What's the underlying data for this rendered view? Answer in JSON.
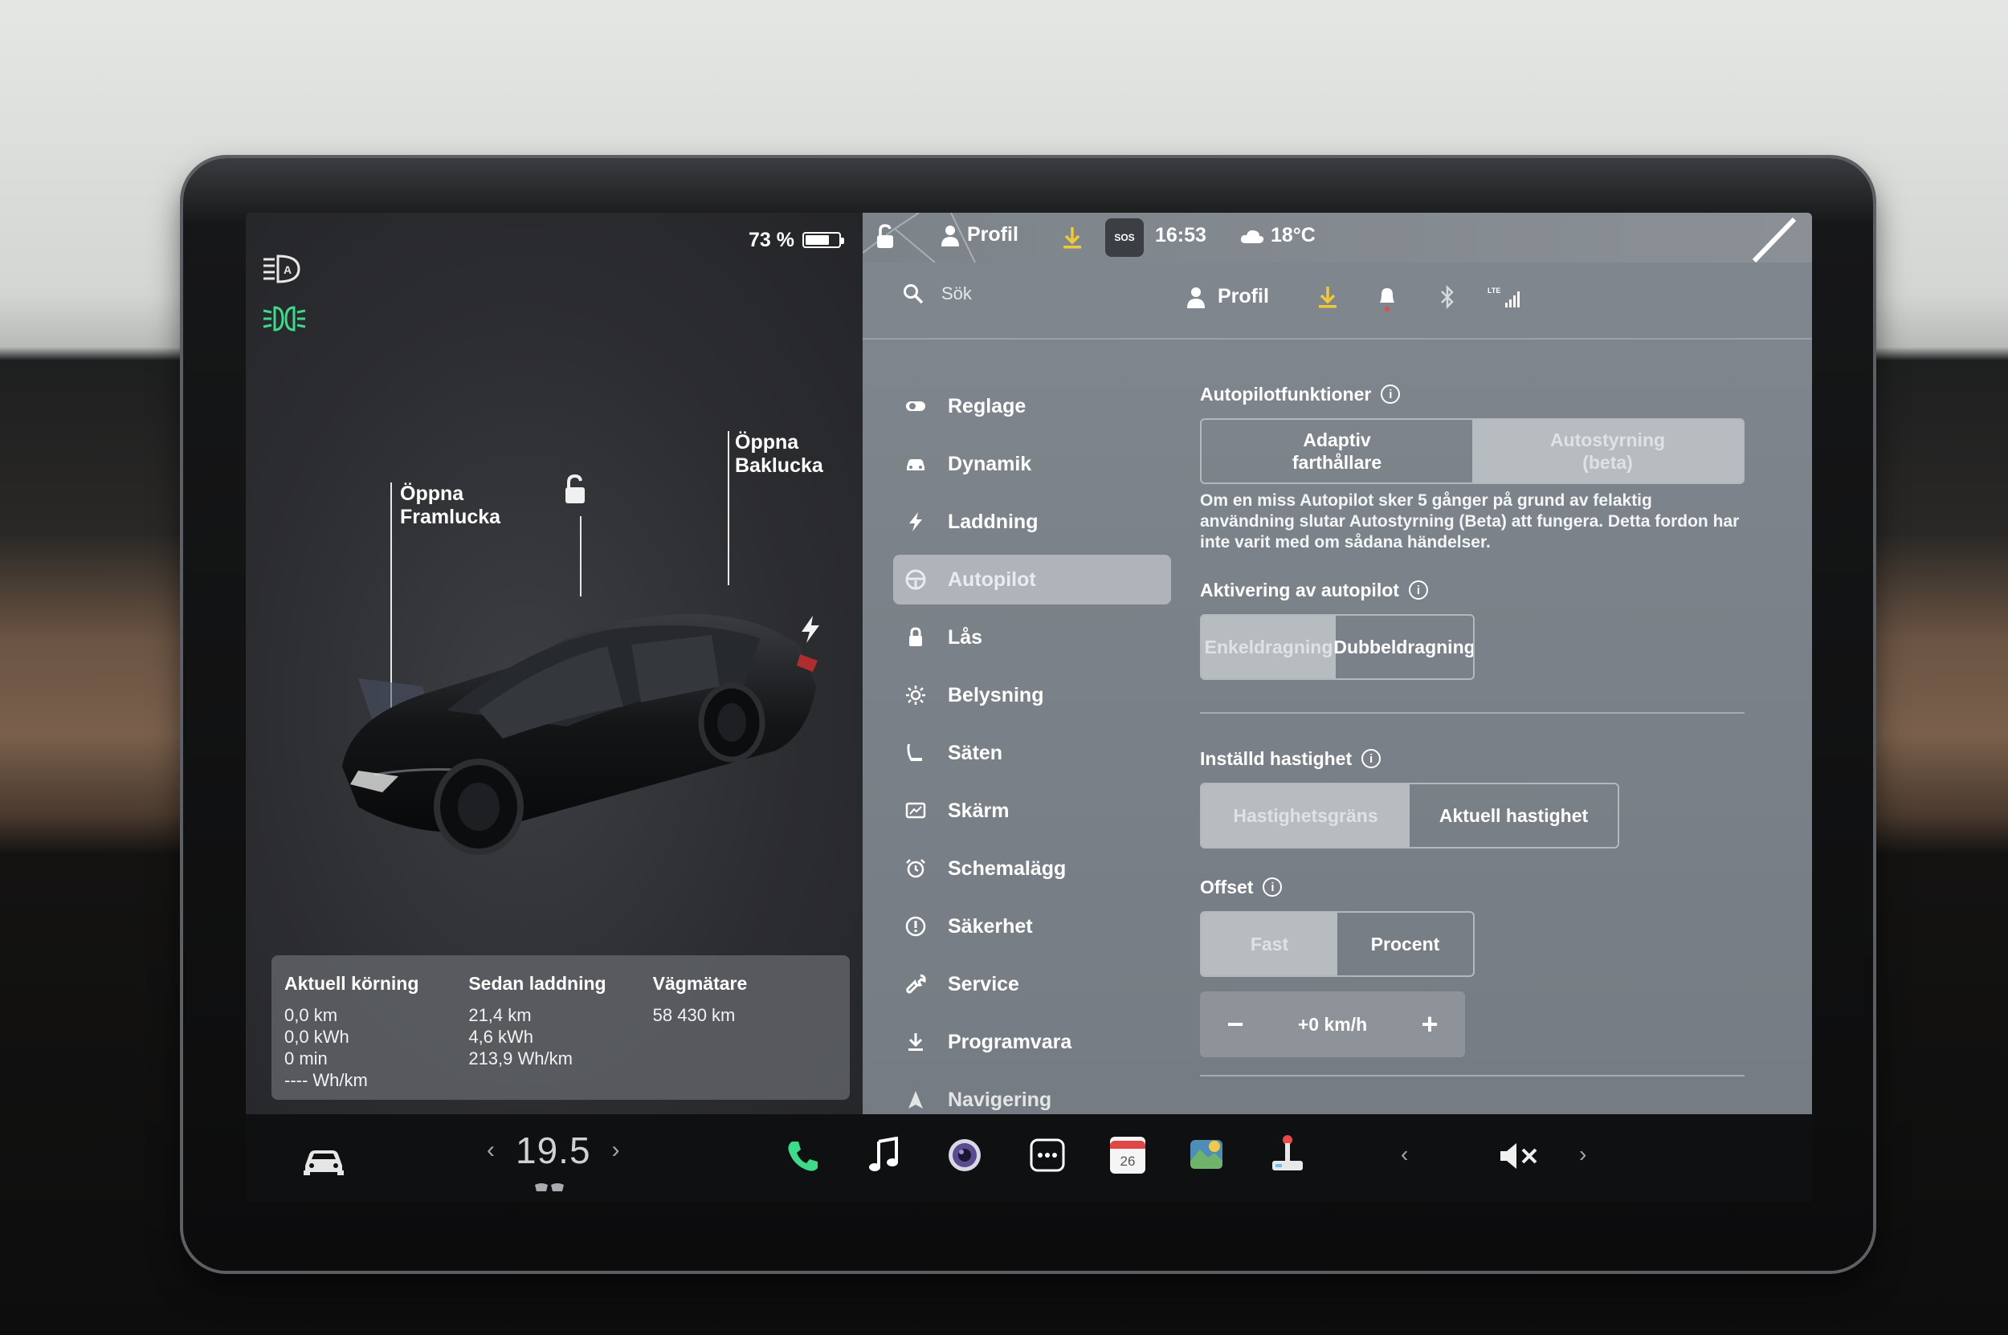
{
  "status": {
    "battery_percent": "73 %",
    "battery_level": 0.73,
    "profile": "Profil",
    "sos": "SOS",
    "time": "16:53",
    "temperature": "18°C"
  },
  "car": {
    "frunk_label_1": "Öppna",
    "frunk_label_2": "Framlucka",
    "trunk_label_1": "Öppna",
    "trunk_label_2": "Baklucka",
    "colors": {
      "body": "#111214",
      "glass": "#2c2f33",
      "highlight": "#4a4d52"
    }
  },
  "stats": {
    "current_drive": {
      "title": "Aktuell körning",
      "lines": [
        "0,0 km",
        "0,0 kWh",
        "0 min",
        "---- Wh/km"
      ]
    },
    "since_charge": {
      "title": "Sedan laddning",
      "lines": [
        "21,4 km",
        "4,6 kWh",
        "213,9 Wh/km"
      ]
    },
    "odometer": {
      "title": "Vägmätare",
      "lines": [
        "58 430 km"
      ]
    }
  },
  "header": {
    "search_placeholder": "Sök",
    "profile": "Profil"
  },
  "menu": [
    {
      "label": "Reglage",
      "icon": "toggle-icon"
    },
    {
      "label": "Dynamik",
      "icon": "car-icon"
    },
    {
      "label": "Laddning",
      "icon": "bolt-icon"
    },
    {
      "label": "Autopilot",
      "icon": "steering-wheel-icon",
      "active": true
    },
    {
      "label": "Lås",
      "icon": "lock-icon"
    },
    {
      "label": "Belysning",
      "icon": "sun-icon"
    },
    {
      "label": "Säten",
      "icon": "seat-icon"
    },
    {
      "label": "Skärm",
      "icon": "display-icon"
    },
    {
      "label": "Schemalägg",
      "icon": "alarm-clock-icon"
    },
    {
      "label": "Säkerhet",
      "icon": "alert-circle-icon"
    },
    {
      "label": "Service",
      "icon": "wrench-icon"
    },
    {
      "label": "Programvara",
      "icon": "download-icon"
    },
    {
      "label": "Navigering",
      "icon": "navigation-icon"
    }
  ],
  "autopilot": {
    "features_title": "Autopilotfunktioner",
    "features_options": [
      {
        "label_1": "Adaptiv",
        "label_2": "farthållare",
        "selected": false
      },
      {
        "label_1": "Autostyrning",
        "label_2": "(beta)",
        "selected": true
      }
    ],
    "features_description": "Om en miss Autopilot sker 5 gånger på grund av felaktig användning slutar Autostyrning (Beta) att fungera. Detta fordon har inte varit med om sådana händelser.",
    "activation_title": "Aktivering av autopilot",
    "activation_options": [
      {
        "label": "Enkeldragning",
        "selected": true
      },
      {
        "label": "Dubbeldragning",
        "selected": false
      }
    ],
    "speed_title": "Inställd hastighet",
    "speed_options": [
      {
        "label": "Hastighetsgräns",
        "selected": true
      },
      {
        "label": "Aktuell hastighet",
        "selected": false
      }
    ],
    "offset_title": "Offset",
    "offset_options": [
      {
        "label": "Fast",
        "selected": true
      },
      {
        "label": "Procent",
        "selected": false
      }
    ],
    "offset_value": "+0 km/h",
    "minus": "−",
    "plus": "+"
  },
  "dock": {
    "temperature": "19.5",
    "left_chevron": "‹",
    "right_chevron": "›",
    "calendar_day": "26"
  }
}
